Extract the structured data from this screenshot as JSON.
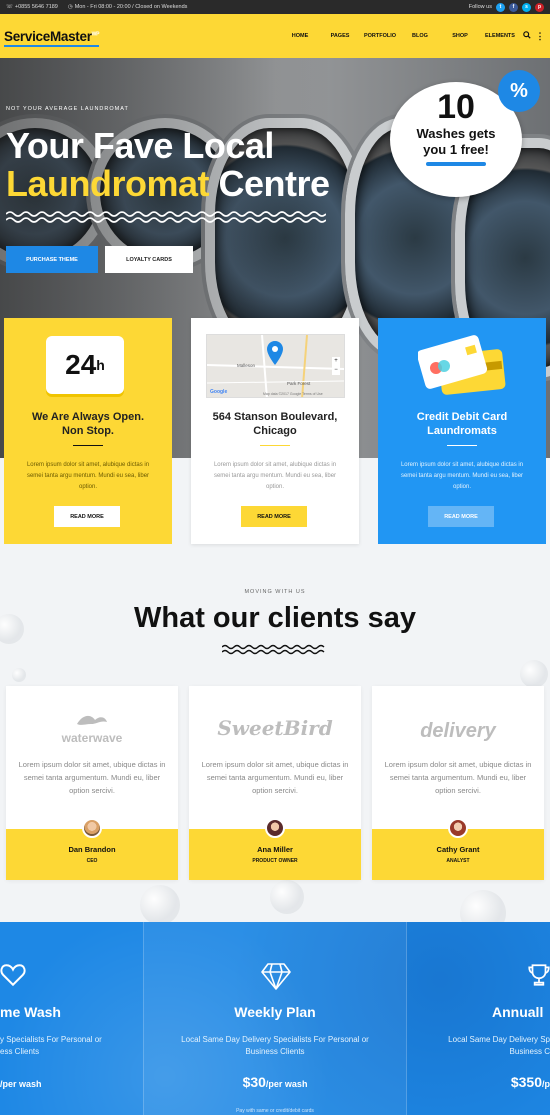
{
  "topbar": {
    "phone": "+0855 5646 7189",
    "hours": "Mon - Fri 08:00 - 20:00 / Closed on Weekends",
    "follow": "Follow us",
    "social": [
      {
        "icon": "twitter-icon",
        "glyph": "t",
        "color": "#1da1f2"
      },
      {
        "icon": "facebook-icon",
        "glyph": "f",
        "color": "#3b5998"
      },
      {
        "icon": "skype-icon",
        "glyph": "s",
        "color": "#00aff0"
      },
      {
        "icon": "pinterest-icon",
        "glyph": "p",
        "color": "#cb2027"
      }
    ]
  },
  "header": {
    "logo": "ServiceMaster",
    "logo_sup": "WP",
    "menu": [
      "HOME",
      "PAGES",
      "PORTFOLIO",
      "BLOG",
      "SHOP",
      "ELEMENTS"
    ]
  },
  "hero": {
    "eyebrow": "NOT YOUR AVERAGE LAUNDROMAT",
    "line1": "Your Fave Local",
    "line2_highlight": "Laundromat",
    "line2_rest": " Centre",
    "btn_primary": "PURCHASE THEME",
    "btn_secondary": "LOYALTY CARDS",
    "promo_number": "10",
    "promo_line1": "Washes gets",
    "promo_line2": "you 1 free!",
    "promo_badge": "%"
  },
  "features": [
    {
      "badge": "24",
      "badge_sup": "h",
      "title1": "We Are Always Open.",
      "title2": "Non Stop.",
      "body": "Lorem ipsum dolor sit amet, alubique dictas in semei tanta argu mentum. Mundi eu sea, liber option.",
      "button": "READ MORE"
    },
    {
      "title1": "564 Stanson Boulevard,",
      "title2": "Chicago",
      "body": "Lorem ipsum dolor sit amet, alubique dictas in semei tanta argu mentum. Mundi eu sea, liber option.",
      "button": "READ MORE",
      "map_label": "Google",
      "map_copy": "Map data ©2017 Google   Terms of Use",
      "map_places": [
        "Malleson",
        "Park Forest"
      ]
    },
    {
      "title1": "Credit Debit Card",
      "title2": "Laundromats",
      "body": "Lorem ipsum dolor sit amet, alubique dictas in semei tanta argu mentum. Mundi eu sea, liber option.",
      "button": "READ MORE"
    }
  ],
  "testimonials": {
    "eyebrow": "MOVING WITH US",
    "title": "What our clients say",
    "items": [
      {
        "logo": "waterwave",
        "quote": "Lorem ipsum dolor sit amet, ubique dictas in semei tanta argumentum. Mundi eu, liber option sercivi.",
        "name": "Dan Brandon",
        "role": "CEO"
      },
      {
        "logo": "SweetBird",
        "quote": "Lorem ipsum dolor sit amet, ubique dictas in semei tanta argumentum. Mundi eu, liber option sercivi.",
        "name": "Ana Miller",
        "role": "PRODUCT OWNER"
      },
      {
        "logo": "delivery",
        "quote": "Lorem ipsum dolor sit amet, ubique dictas in semei tanta argumentum. Mundi eu, liber option sercivi.",
        "name": "Cathy Grant",
        "role": "ANALYST"
      }
    ]
  },
  "pricing": [
    {
      "icon": "heart-icon",
      "title": "me Wash",
      "desc1": "y Specialists For Personal or",
      "desc2": "ess Clients",
      "price": "",
      "per": "/per wash",
      "foot": ""
    },
    {
      "icon": "diamond-icon",
      "title": "Weekly Plan",
      "desc1": "Local Same Day Delivery Specialists For Personal or",
      "desc2": "Business Clients",
      "price": "$30",
      "per": "/per wash",
      "foot": "Pay with same or credit/debit cards"
    },
    {
      "icon": "trophy-icon",
      "title": "Annuall",
      "desc1": "Local Same Day Delivery Sp",
      "desc2": "Business C",
      "price": "$350",
      "per": "/p",
      "foot": ""
    }
  ],
  "colors": {
    "yellow": "#fdd835",
    "blue": "#1e88e5",
    "dark": "#2a2a2a"
  }
}
